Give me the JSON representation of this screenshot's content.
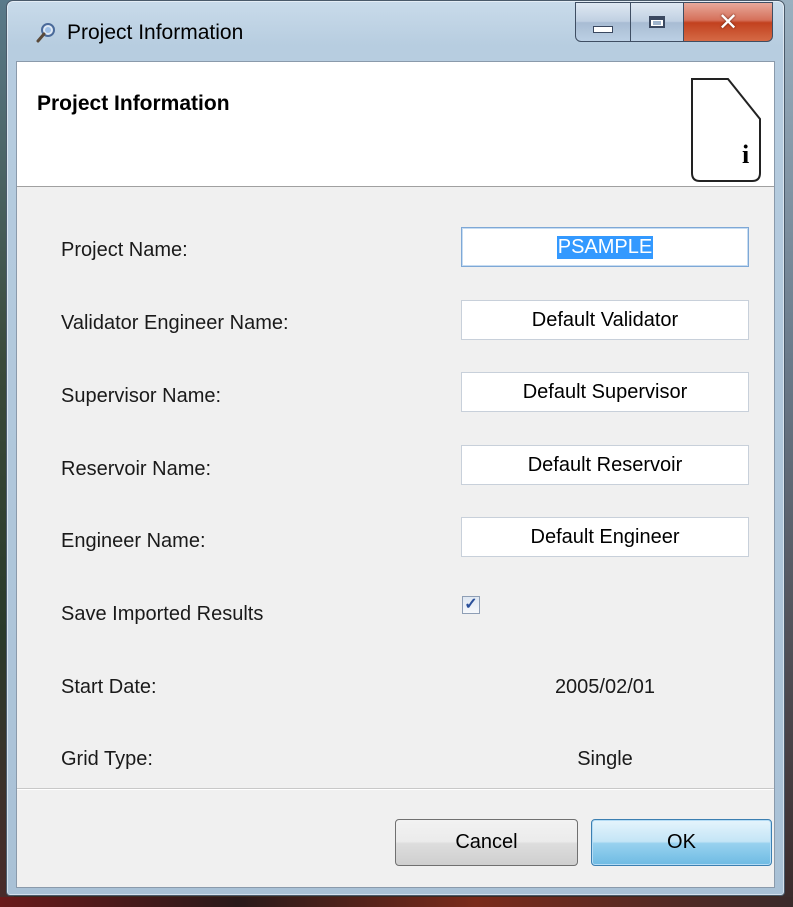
{
  "window": {
    "title": "Project Information"
  },
  "header": {
    "title": "Project Information",
    "badge_letter": "i"
  },
  "form": {
    "project_name_label": "Project Name:",
    "project_name_value": "PSAMPLE",
    "validator_label": "Validator Engineer Name:",
    "validator_value": "Default Validator",
    "supervisor_label": "Supervisor Name:",
    "supervisor_value": "Default Supervisor",
    "reservoir_label": "Reservoir Name:",
    "reservoir_value": "Default Reservoir",
    "engineer_label": "Engineer Name:",
    "engineer_value": "Default Engineer",
    "save_results_label": "Save Imported Results",
    "save_results_checked": true,
    "start_date_label": "Start Date:",
    "start_date_value": "2005/02/01",
    "grid_type_label": "Grid Type:",
    "grid_type_value": "Single"
  },
  "buttons": {
    "cancel": "Cancel",
    "ok": "OK"
  },
  "colors": {
    "selection": "#3399ff",
    "ok_button": "#98d1ef",
    "close_button": "#c2411f"
  },
  "icons": {
    "app": "magnifier-icon",
    "minimize": "minimize-icon",
    "maximize": "maximize-icon",
    "close": "close-icon",
    "info": "info-page-icon"
  }
}
